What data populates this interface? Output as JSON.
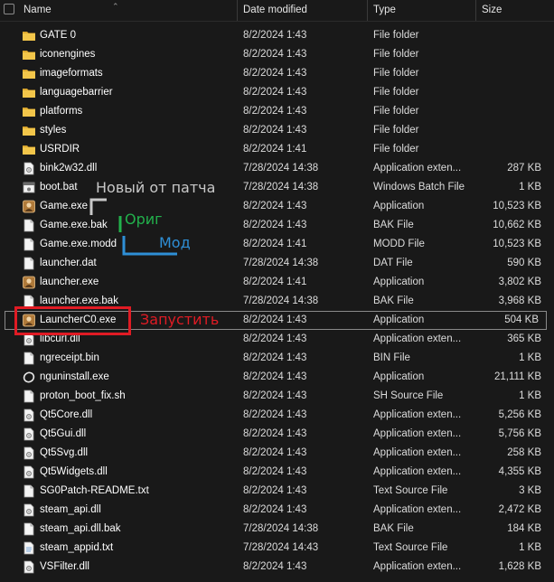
{
  "header": {
    "name": "Name",
    "date_modified": "Date modified",
    "type": "Type",
    "size": "Size"
  },
  "colors": {
    "background": "#191919",
    "folder": "#f0c040",
    "annot_gray": "#c8c8c8",
    "annot_green": "#22b14c",
    "annot_blue": "#2e8fd6",
    "annot_red": "#e01b24"
  },
  "files": [
    {
      "name": "GATE 0",
      "date": "8/2/2024 1:43",
      "type": "File folder",
      "size": "",
      "icon": "folder-icon"
    },
    {
      "name": "iconengines",
      "date": "8/2/2024 1:43",
      "type": "File folder",
      "size": "",
      "icon": "folder-icon"
    },
    {
      "name": "imageformats",
      "date": "8/2/2024 1:43",
      "type": "File folder",
      "size": "",
      "icon": "folder-icon"
    },
    {
      "name": "languagebarrier",
      "date": "8/2/2024 1:43",
      "type": "File folder",
      "size": "",
      "icon": "folder-icon"
    },
    {
      "name": "platforms",
      "date": "8/2/2024 1:43",
      "type": "File folder",
      "size": "",
      "icon": "folder-icon"
    },
    {
      "name": "styles",
      "date": "8/2/2024 1:43",
      "type": "File folder",
      "size": "",
      "icon": "folder-icon"
    },
    {
      "name": "USRDIR",
      "date": "8/2/2024 1:41",
      "type": "File folder",
      "size": "",
      "icon": "folder-icon"
    },
    {
      "name": "bink2w32.dll",
      "date": "7/28/2024 14:38",
      "type": "Application exten...",
      "size": "287 KB",
      "icon": "dll-icon"
    },
    {
      "name": "boot.bat",
      "date": "7/28/2024 14:38",
      "type": "Windows Batch File",
      "size": "1 KB",
      "icon": "bat-icon"
    },
    {
      "name": "Game.exe",
      "date": "8/2/2024 1:43",
      "type": "Application",
      "size": "10,523 KB",
      "icon": "game-exe-icon"
    },
    {
      "name": "Game.exe.bak",
      "date": "8/2/2024 1:43",
      "type": "BAK File",
      "size": "10,662 KB",
      "icon": "file-icon"
    },
    {
      "name": "Game.exe.modd",
      "date": "8/2/2024 1:41",
      "type": "MODD File",
      "size": "10,523 KB",
      "icon": "file-icon"
    },
    {
      "name": "launcher.dat",
      "date": "7/28/2024 14:38",
      "type": "DAT File",
      "size": "590 KB",
      "icon": "file-icon"
    },
    {
      "name": "launcher.exe",
      "date": "8/2/2024 1:41",
      "type": "Application",
      "size": "3,802 KB",
      "icon": "game-exe-icon"
    },
    {
      "name": "launcher.exe.bak",
      "date": "7/28/2024 14:38",
      "type": "BAK File",
      "size": "3,968 KB",
      "icon": "file-icon"
    },
    {
      "name": "LauncherC0.exe",
      "date": "8/2/2024 1:43",
      "type": "Application",
      "size": "504 KB",
      "icon": "game-exe-icon",
      "selected": true
    },
    {
      "name": "libcurl.dll",
      "date": "8/2/2024 1:43",
      "type": "Application exten...",
      "size": "365 KB",
      "icon": "dll-icon"
    },
    {
      "name": "ngreceipt.bin",
      "date": "8/2/2024 1:43",
      "type": "BIN File",
      "size": "1 KB",
      "icon": "file-icon"
    },
    {
      "name": "nguninstall.exe",
      "date": "8/2/2024 1:43",
      "type": "Application",
      "size": "21,111 KB",
      "icon": "uninstall-icon"
    },
    {
      "name": "proton_boot_fix.sh",
      "date": "8/2/2024 1:43",
      "type": "SH Source File",
      "size": "1 KB",
      "icon": "file-icon"
    },
    {
      "name": "Qt5Core.dll",
      "date": "8/2/2024 1:43",
      "type": "Application exten...",
      "size": "5,256 KB",
      "icon": "dll-icon"
    },
    {
      "name": "Qt5Gui.dll",
      "date": "8/2/2024 1:43",
      "type": "Application exten...",
      "size": "5,756 KB",
      "icon": "dll-icon"
    },
    {
      "name": "Qt5Svg.dll",
      "date": "8/2/2024 1:43",
      "type": "Application exten...",
      "size": "258 KB",
      "icon": "dll-icon"
    },
    {
      "name": "Qt5Widgets.dll",
      "date": "8/2/2024 1:43",
      "type": "Application exten...",
      "size": "4,355 KB",
      "icon": "dll-icon"
    },
    {
      "name": "SG0Patch-README.txt",
      "date": "8/2/2024 1:43",
      "type": "Text Source File",
      "size": "3 KB",
      "icon": "file-icon"
    },
    {
      "name": "steam_api.dll",
      "date": "8/2/2024 1:43",
      "type": "Application exten...",
      "size": "2,472 KB",
      "icon": "dll-icon"
    },
    {
      "name": "steam_api.dll.bak",
      "date": "7/28/2024 14:38",
      "type": "BAK File",
      "size": "184 KB",
      "icon": "file-icon"
    },
    {
      "name": "steam_appid.txt",
      "date": "7/28/2024 14:43",
      "type": "Text Source File",
      "size": "1 KB",
      "icon": "txt-icon"
    },
    {
      "name": "VSFilter.dll",
      "date": "8/2/2024 1:43",
      "type": "Application exten...",
      "size": "1,628 KB",
      "icon": "dll-icon"
    }
  ],
  "annotations": {
    "new_from_patch": "Новый от патча",
    "orig": "Ориг",
    "mod": "Мод",
    "launch": "Запустить"
  }
}
